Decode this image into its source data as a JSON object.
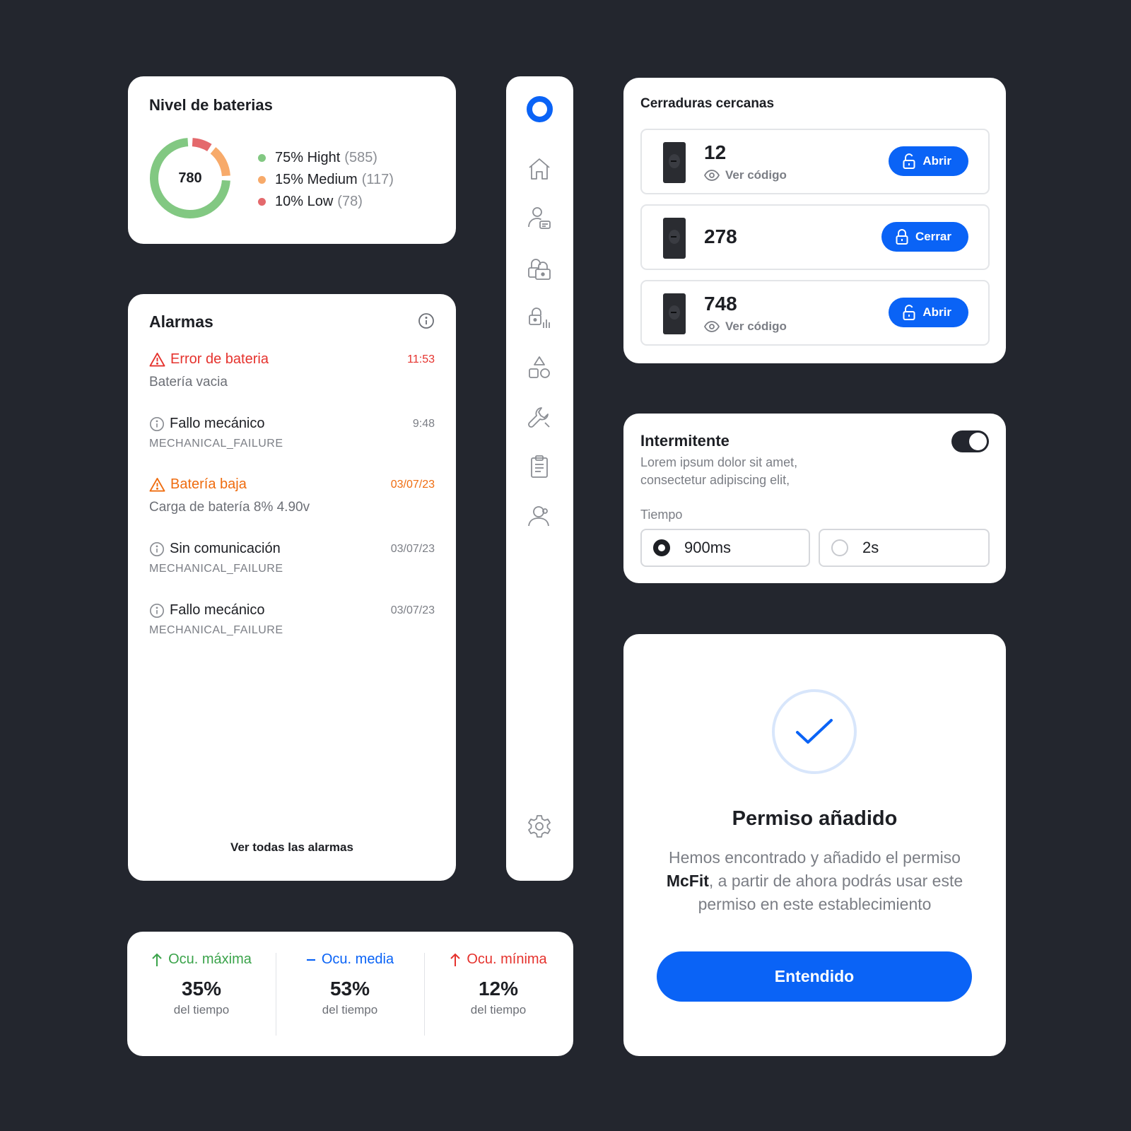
{
  "battery": {
    "title": "Nivel de baterias",
    "total": "780",
    "legend": [
      {
        "label": "75% Hight",
        "count": "(585)",
        "color": "#82c882",
        "fraction": 0.75
      },
      {
        "label": "15% Medium",
        "count": "(117)",
        "color": "#f7aa6a",
        "fraction": 0.15
      },
      {
        "label": "10% Low",
        "count": "(78)",
        "color": "#e4696c",
        "fraction": 0.1
      }
    ]
  },
  "alarms": {
    "title": "Alarmas",
    "items": [
      {
        "title": "Error de bateria",
        "time": "11:53",
        "sub": "Batería vacia",
        "level": "error"
      },
      {
        "title": "Fallo mecánico",
        "time": "9:48",
        "code": "MECHANICAL_FAILURE",
        "level": "info"
      },
      {
        "title": "Batería baja",
        "time": "03/07/23",
        "sub": "Carga de batería 8% 4.90v",
        "level": "warning"
      },
      {
        "title": "Sin comunicación",
        "time": "03/07/23",
        "code": "MECHANICAL_FAILURE",
        "level": "info"
      },
      {
        "title": "Fallo mecánico",
        "time": "03/07/23",
        "code": "MECHANICAL_FAILURE",
        "level": "info"
      }
    ],
    "see_all": "Ver todas las alarmas"
  },
  "sidebar": {
    "items": [
      "home-icon",
      "user-card-icon",
      "locks-icon",
      "lock-signal-icon",
      "shapes-icon",
      "wrench-icon",
      "clipboard-icon",
      "user-settings-icon"
    ],
    "settings": "gear-icon"
  },
  "stats": [
    {
      "label": "Ocu. máxima",
      "value": "35%",
      "sub": "del tiempo",
      "color": "#3aa34a",
      "icon": "arrow-up-icon"
    },
    {
      "label": "Ocu. media",
      "value": "53%",
      "sub": "del tiempo",
      "color": "#0a63f6",
      "icon": "dash-icon"
    },
    {
      "label": "Ocu. mínima",
      "value": "12%",
      "sub": "del tiempo",
      "color": "#e5322d",
      "icon": "arrow-up-icon"
    }
  ],
  "locks": {
    "title": "Cerraduras cercanas",
    "items": [
      {
        "number": "12",
        "code_label": "Ver código",
        "button": "Abrir"
      },
      {
        "number": "278",
        "button": "Cerrar"
      },
      {
        "number": "748",
        "code_label": "Ver código",
        "button": "Abrir"
      }
    ]
  },
  "blink": {
    "title": "Intermitente",
    "desc": "Lorem ipsum dolor sit amet, consectetur adipiscing elit,",
    "enabled": true,
    "tiempo_label": "Tiempo",
    "options": [
      "900ms",
      "2s"
    ],
    "selected": "900ms"
  },
  "permission": {
    "title": "Permiso añadido",
    "body_pre": "Hemos encontrado y añadido el permiso ",
    "body_name": "McFit",
    "body_post": ", a partir de ahora podrás usar este permiso en este establecimiento",
    "button": "Entendido"
  },
  "colors": {
    "accent": "#0a63f6",
    "background": "#23262e",
    "error": "#e5322d",
    "warning": "#ef6c0f"
  }
}
